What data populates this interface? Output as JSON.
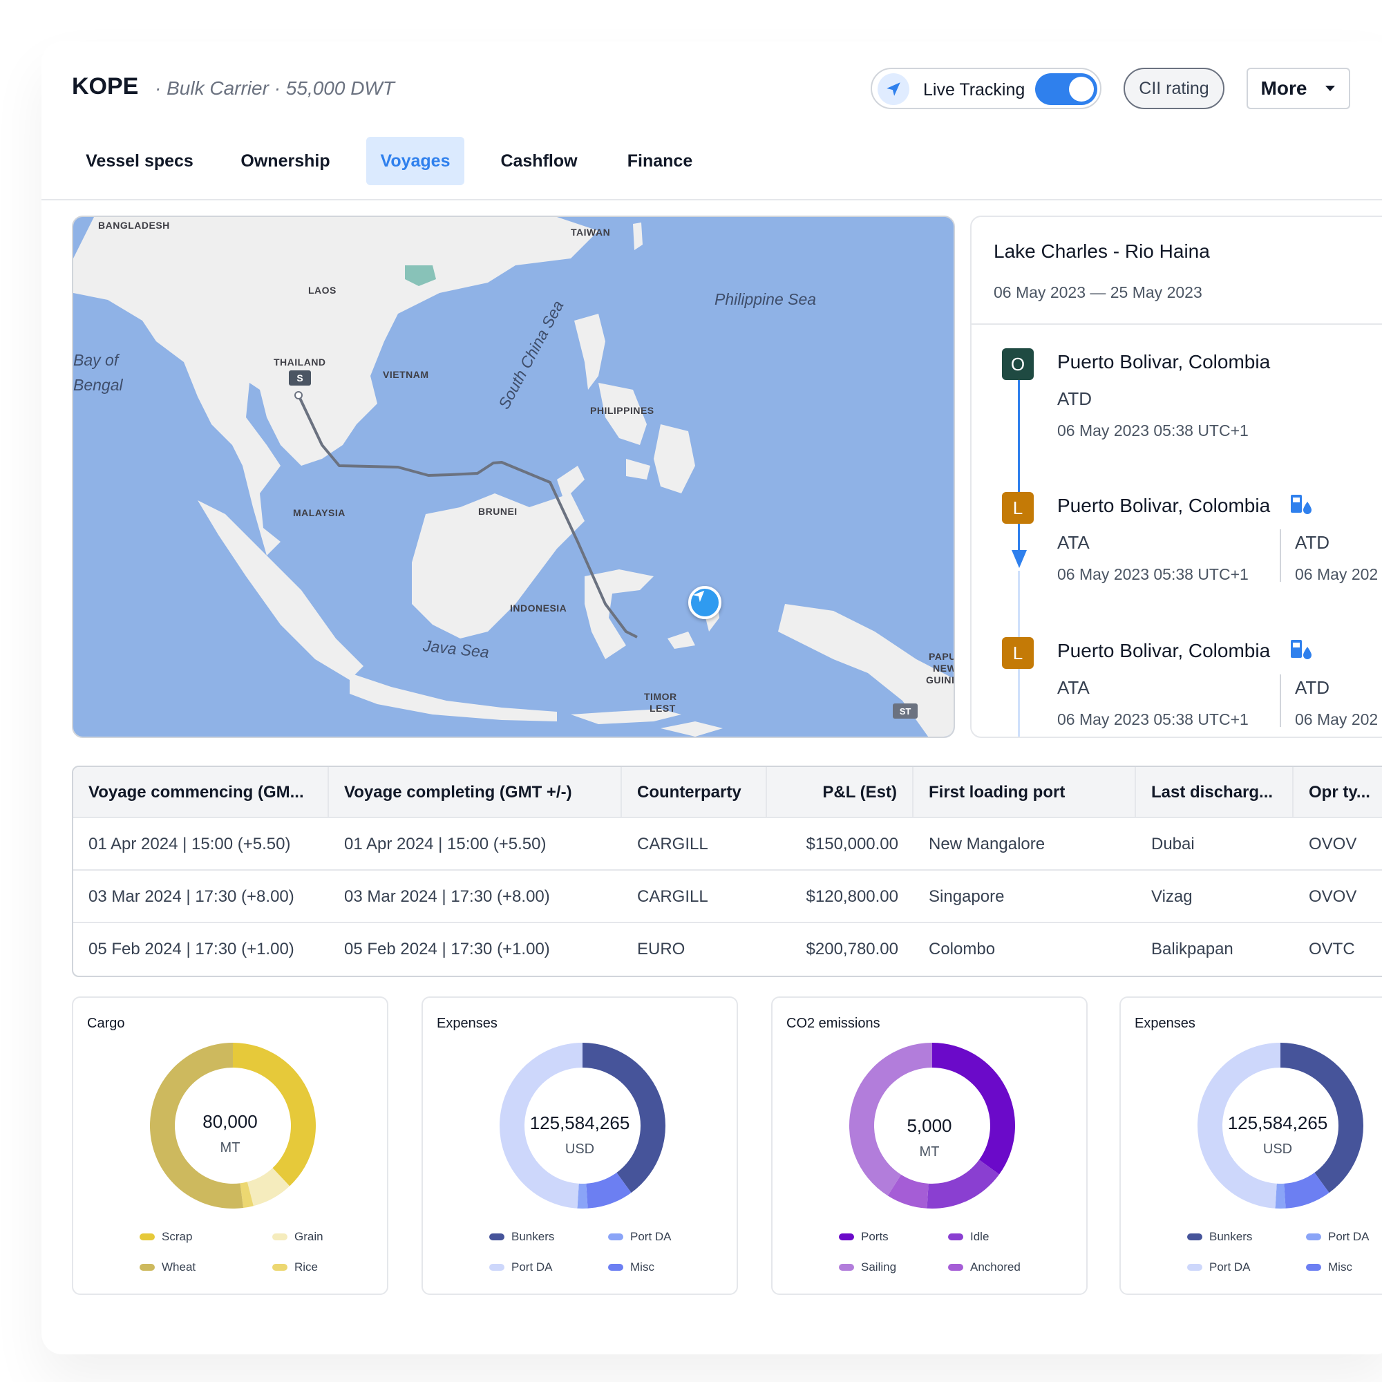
{
  "header": {
    "vessel": "KOPE",
    "subtitle": "· Bulk Carrier · 55,000 DWT",
    "live_label": "Live Tracking",
    "cii_label": "CII rating",
    "more_label": "More"
  },
  "tabs": [
    "Vessel specs",
    "Ownership",
    "Voyages",
    "Cashflow",
    "Finance"
  ],
  "active_tab": "Voyages",
  "map": {
    "labels": [
      "BANGLADESH",
      "TAIWAN",
      "LAOS",
      "THAILAND",
      "VIETNAM",
      "PHILIPPINES",
      "MALAYSIA",
      "BRUNEI",
      "INDONESIA",
      "TIMOR",
      "LEST",
      "PAPUA",
      "NEW",
      "GUINE"
    ],
    "seas": [
      "Philippine Sea",
      "Bay of",
      "Bengal",
      "South China Sea",
      "Java Sea"
    ],
    "start_marker": "S",
    "end_marker": "ST"
  },
  "voyage": {
    "title": "Lake Charles - Rio Haina",
    "dates": "06 May 2023 — 25 May 2023",
    "events": [
      {
        "badge": "O",
        "port": "Puerto Bolivar, Colombia",
        "ata_label": "ATD",
        "ata_time": "06 May 2023 05:38 UTC+1"
      },
      {
        "badge": "L",
        "port": "Puerto Bolivar, Colombia",
        "ata_label": "ATA",
        "ata_time": "06 May 2023 05:38 UTC+1",
        "atd_label": "ATD",
        "atd_time": "06 May 202"
      },
      {
        "badge": "L",
        "port": "Puerto Bolivar, Colombia",
        "ata_label": "ATA",
        "ata_time": "06 May 2023 05:38 UTC+1",
        "atd_label": "ATD",
        "atd_time": "06 May 202"
      }
    ]
  },
  "table": {
    "columns": [
      "Voyage commencing (GM...",
      "Voyage completing (GMT +/-)",
      "Counterparty",
      "P&L (Est)",
      "First loading port",
      "Last discharg...",
      "Opr ty..."
    ],
    "rows": [
      [
        "01 Apr 2024 | 15:00 (+5.50)",
        "01 Apr 2024 | 15:00 (+5.50)",
        "CARGILL",
        "$150,000.00",
        "New Mangalore",
        "Dubai",
        "OVOV"
      ],
      [
        "03 Mar 2024 | 17:30 (+8.00)",
        "03 Mar 2024 | 17:30 (+8.00)",
        "CARGILL",
        "$120,800.00",
        "Singapore",
        "Vizag",
        "OVOV"
      ],
      [
        "05 Feb 2024 | 17:30 (+1.00)",
        "05 Feb 2024 | 17:30 (+1.00)",
        "EURO",
        "$200,780.00",
        "Colombo",
        "Balikpapan",
        "OVTC"
      ]
    ]
  },
  "cards": [
    {
      "title": "Cargo",
      "value": "80,000",
      "unit": "MT",
      "segments": [
        {
          "label": "Scrap",
          "value": 0.38,
          "color": "#e6c93a"
        },
        {
          "label": "Grain",
          "value": 0.08,
          "color": "#f5ecbd"
        },
        {
          "label": "Rice",
          "value": 0.02,
          "color": "#ecd771"
        },
        {
          "label": "Wheat",
          "value": 0.52,
          "color": "#cdb95e"
        }
      ],
      "legend": [
        {
          "label": "Scrap",
          "color": "#e6c93a"
        },
        {
          "label": "Grain",
          "color": "#f5ecbd"
        },
        {
          "label": "Wheat",
          "color": "#cdb95e"
        },
        {
          "label": "Rice",
          "color": "#ecd771"
        }
      ]
    },
    {
      "title": "Expenses",
      "value": "125,584,265",
      "unit": "USD",
      "segments": [
        {
          "label": "Bunkers",
          "value": 0.4,
          "color": "#46549a"
        },
        {
          "label": "Misc",
          "value": 0.09,
          "color": "#6c7ff2"
        },
        {
          "label": "Port DA",
          "value": 0.02,
          "color": "#8aa4f7"
        },
        {
          "label": "Port DA",
          "value": 0.49,
          "color": "#cdd7fb"
        }
      ],
      "legend": [
        {
          "label": "Bunkers",
          "color": "#46549a"
        },
        {
          "label": "Port DA",
          "color": "#8aa4f7"
        },
        {
          "label": "Port DA",
          "color": "#cdd7fb"
        },
        {
          "label": "Misc",
          "color": "#6c7ff2"
        }
      ]
    },
    {
      "title": "CO2 emissions",
      "value": "5,000",
      "unit": "MT",
      "segments": [
        {
          "label": "Ports",
          "value": 0.35,
          "color": "#6b0ac9"
        },
        {
          "label": "Idle",
          "value": 0.16,
          "color": "#8a3fd1"
        },
        {
          "label": "Anchored",
          "value": 0.08,
          "color": "#a55dd6"
        },
        {
          "label": "Sailing",
          "value": 0.41,
          "color": "#b27ddb"
        }
      ],
      "legend": [
        {
          "label": "Ports",
          "color": "#6b0ac9"
        },
        {
          "label": "Idle",
          "color": "#8a3fd1"
        },
        {
          "label": "Sailing",
          "color": "#b27ddb"
        },
        {
          "label": "Anchored",
          "color": "#a55dd6"
        }
      ]
    },
    {
      "title": "Expenses",
      "value": "125,584,265",
      "unit": "USD",
      "segments": [
        {
          "label": "Bunkers",
          "value": 0.4,
          "color": "#46549a"
        },
        {
          "label": "Misc",
          "value": 0.09,
          "color": "#6c7ff2"
        },
        {
          "label": "Port DA",
          "value": 0.02,
          "color": "#8aa4f7"
        },
        {
          "label": "Port DA",
          "value": 0.49,
          "color": "#cdd7fb"
        }
      ],
      "legend": [
        {
          "label": "Bunkers",
          "color": "#46549a"
        },
        {
          "label": "Port DA",
          "color": "#8aa4f7"
        },
        {
          "label": "Port DA",
          "color": "#cdd7fb"
        },
        {
          "label": "Misc",
          "color": "#6c7ff2"
        }
      ]
    }
  ]
}
